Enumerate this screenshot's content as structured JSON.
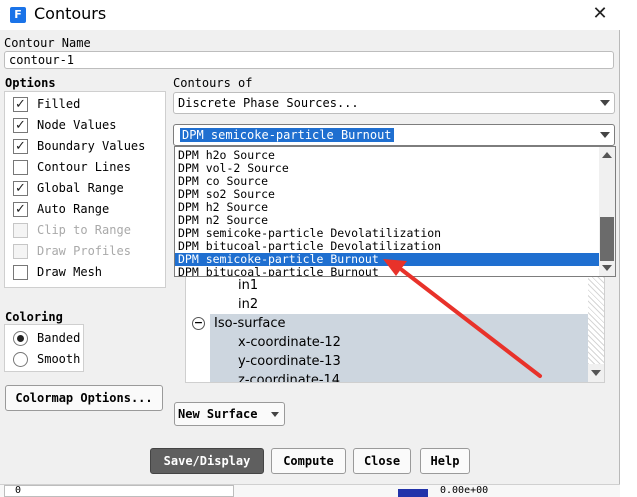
{
  "window": {
    "title": "Contours",
    "app_icon": "F"
  },
  "contour_name": {
    "label": "Contour Name",
    "value": "contour-1"
  },
  "options": {
    "label": "Options",
    "items": [
      {
        "label": "Filled",
        "checked": true,
        "enabled": true
      },
      {
        "label": "Node Values",
        "checked": true,
        "enabled": true
      },
      {
        "label": "Boundary Values",
        "checked": true,
        "enabled": true
      },
      {
        "label": "Contour Lines",
        "checked": false,
        "enabled": true
      },
      {
        "label": "Global Range",
        "checked": true,
        "enabled": true
      },
      {
        "label": "Auto Range",
        "checked": true,
        "enabled": true
      },
      {
        "label": "Clip to Range",
        "checked": false,
        "enabled": false
      },
      {
        "label": "Draw Profiles",
        "checked": false,
        "enabled": false
      },
      {
        "label": "Draw Mesh",
        "checked": false,
        "enabled": true
      }
    ]
  },
  "coloring": {
    "label": "Coloring",
    "options": [
      {
        "label": "Banded",
        "selected": true
      },
      {
        "label": "Smooth",
        "selected": false
      }
    ]
  },
  "colormap_button": "Colormap Options...",
  "contours_of": {
    "label": "Contours of",
    "category": "Discrete Phase Sources...",
    "selected": "DPM semicoke-particle Burnout",
    "dropdown_items": [
      "DPM h2o Source",
      "DPM vol-2 Source",
      "DPM co Source",
      "DPM so2 Source",
      "DPM h2 Source",
      "DPM n2 Source",
      "DPM semicoke-particle Devolatilization",
      "DPM bitucoal-particle Devolatilization",
      "DPM semicoke-particle Burnout",
      "DPM bitucoal-particle Burnout"
    ],
    "selected_index": 8
  },
  "surfaces": {
    "items": [
      "in1",
      "in2"
    ],
    "group": "Iso-surface",
    "group_items": [
      "x-coordinate-12",
      "y-coordinate-13",
      "z-coordinate-14"
    ]
  },
  "new_surface_button": "New Surface",
  "buttons": {
    "save_display": "Save/Display",
    "compute": "Compute",
    "close": "Close",
    "help": "Help"
  },
  "bottom_strip": {
    "left_value": "0",
    "right_value": "0.00e+00"
  },
  "annotation_color": "#e8322a",
  "selection_color": "#1f6fd0"
}
